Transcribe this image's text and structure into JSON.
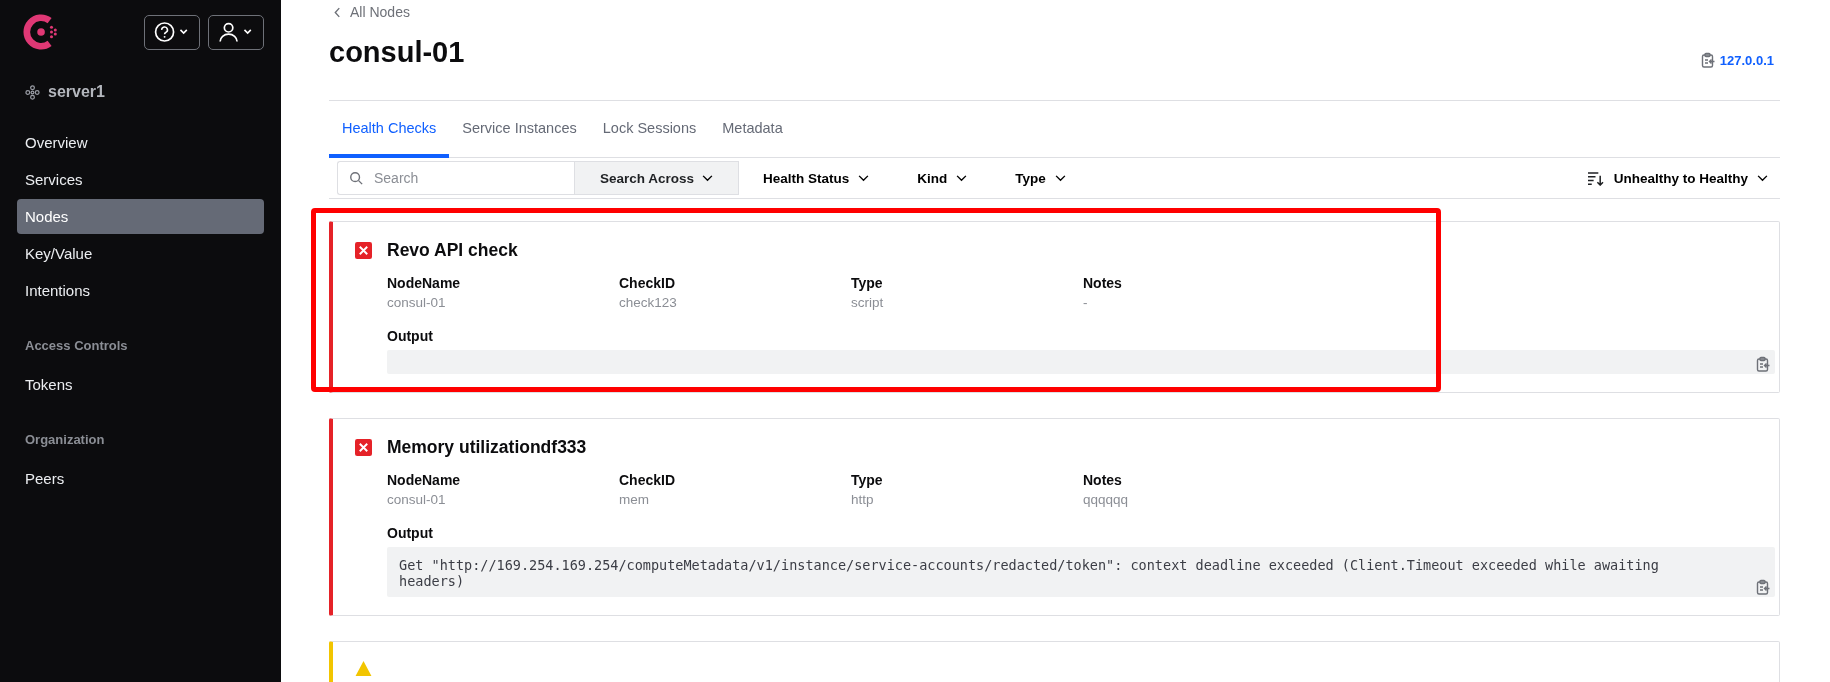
{
  "sidebar": {
    "datacenter": "server1",
    "sections": [
      {
        "items": [
          {
            "label": "Overview",
            "selected": false
          },
          {
            "label": "Services",
            "selected": false
          },
          {
            "label": "Nodes",
            "selected": true
          },
          {
            "label": "Key/Value",
            "selected": false
          },
          {
            "label": "Intentions",
            "selected": false
          }
        ]
      },
      {
        "heading": "Access Controls",
        "items": [
          {
            "label": "Tokens",
            "selected": false
          }
        ]
      },
      {
        "heading": "Organization",
        "items": [
          {
            "label": "Peers",
            "selected": false
          }
        ]
      }
    ]
  },
  "breadcrumb": "All Nodes",
  "title": "consul-01",
  "address": "127.0.0.1",
  "tabs": [
    {
      "label": "Health Checks",
      "selected": true
    },
    {
      "label": "Service Instances",
      "selected": false
    },
    {
      "label": "Lock Sessions",
      "selected": false
    },
    {
      "label": "Metadata",
      "selected": false
    }
  ],
  "filters": {
    "search_placeholder": "Search",
    "search_across": "Search Across",
    "dropdowns": [
      "Health Status",
      "Kind",
      "Type"
    ],
    "sort": "Unhealthy to Healthy"
  },
  "checks": [
    {
      "kind": "critical",
      "highlighted": true,
      "name": "Revo API check",
      "fields": [
        {
          "label": "NodeName",
          "value": "consul-01"
        },
        {
          "label": "CheckID",
          "value": "check123"
        },
        {
          "label": "Type",
          "value": "script"
        },
        {
          "label": "Notes",
          "value": "-"
        }
      ],
      "output_label": "Output"
    },
    {
      "kind": "critical",
      "highlighted": false,
      "name": "Memory utilizationdf333",
      "fields": [
        {
          "label": "NodeName",
          "value": "consul-01"
        },
        {
          "label": "CheckID",
          "value": "mem"
        },
        {
          "label": "Type",
          "value": "http"
        },
        {
          "label": "Notes",
          "value": "qqqqqq"
        }
      ],
      "output_label": "Output",
      "output": "Get \"http://169.254.169.254/computeMetadata/v1/instance/service-accounts/redacted/token\": context deadline exceeded (Client.Timeout exceeded while awaiting headers)"
    },
    {
      "kind": "warning",
      "highlighted": false
    }
  ]
}
